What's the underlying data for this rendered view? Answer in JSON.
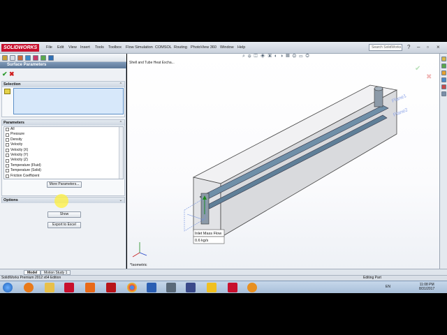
{
  "app": {
    "logo": "SOLIDWORKS"
  },
  "menu": [
    "File",
    "Edit",
    "View",
    "Insert",
    "Tools",
    "Toolbox",
    "Flow Simulation",
    "COMSOL",
    "Routing",
    "PhotoView 360",
    "Window",
    "Help"
  ],
  "search": {
    "placeholder": "Search SolidWorks"
  },
  "panel": {
    "title": "Surface Parameters",
    "selection_label": "Selection",
    "parameters_label": "Parameters",
    "options_label": "Options",
    "parameters": [
      "All",
      "Pressure",
      "Density",
      "Velocity",
      "Velocity (X)",
      "Velocity (Y)",
      "Velocity (Z)",
      "Temperature (Fluid)",
      "Temperature (Solid)",
      "Friction Coefficient"
    ],
    "more_button": "More Parameters...",
    "show_button": "Show",
    "export_button": "Export to Excel"
  },
  "viewport": {
    "tree_label": "Shell and Tube Heat Excha...",
    "view_label": "*Isometric",
    "annotation_label": "Inlet Mass Flow",
    "annotation_value": "0.6 kg/s",
    "plane1": "Plane1",
    "plane2": "Plane2"
  },
  "tabs": [
    "Model",
    "Motion Study 1"
  ],
  "status": {
    "left": "SolidWorks Premium 2012 x64 Edition",
    "right": "Editing Part"
  },
  "taskbar": {
    "lang": "EN",
    "time": "11:08 PM",
    "date": "8/31/2017"
  },
  "colors": {
    "accent": "#c8102e",
    "selection": "#d7e8fa",
    "panel_header": "#5b7797"
  }
}
